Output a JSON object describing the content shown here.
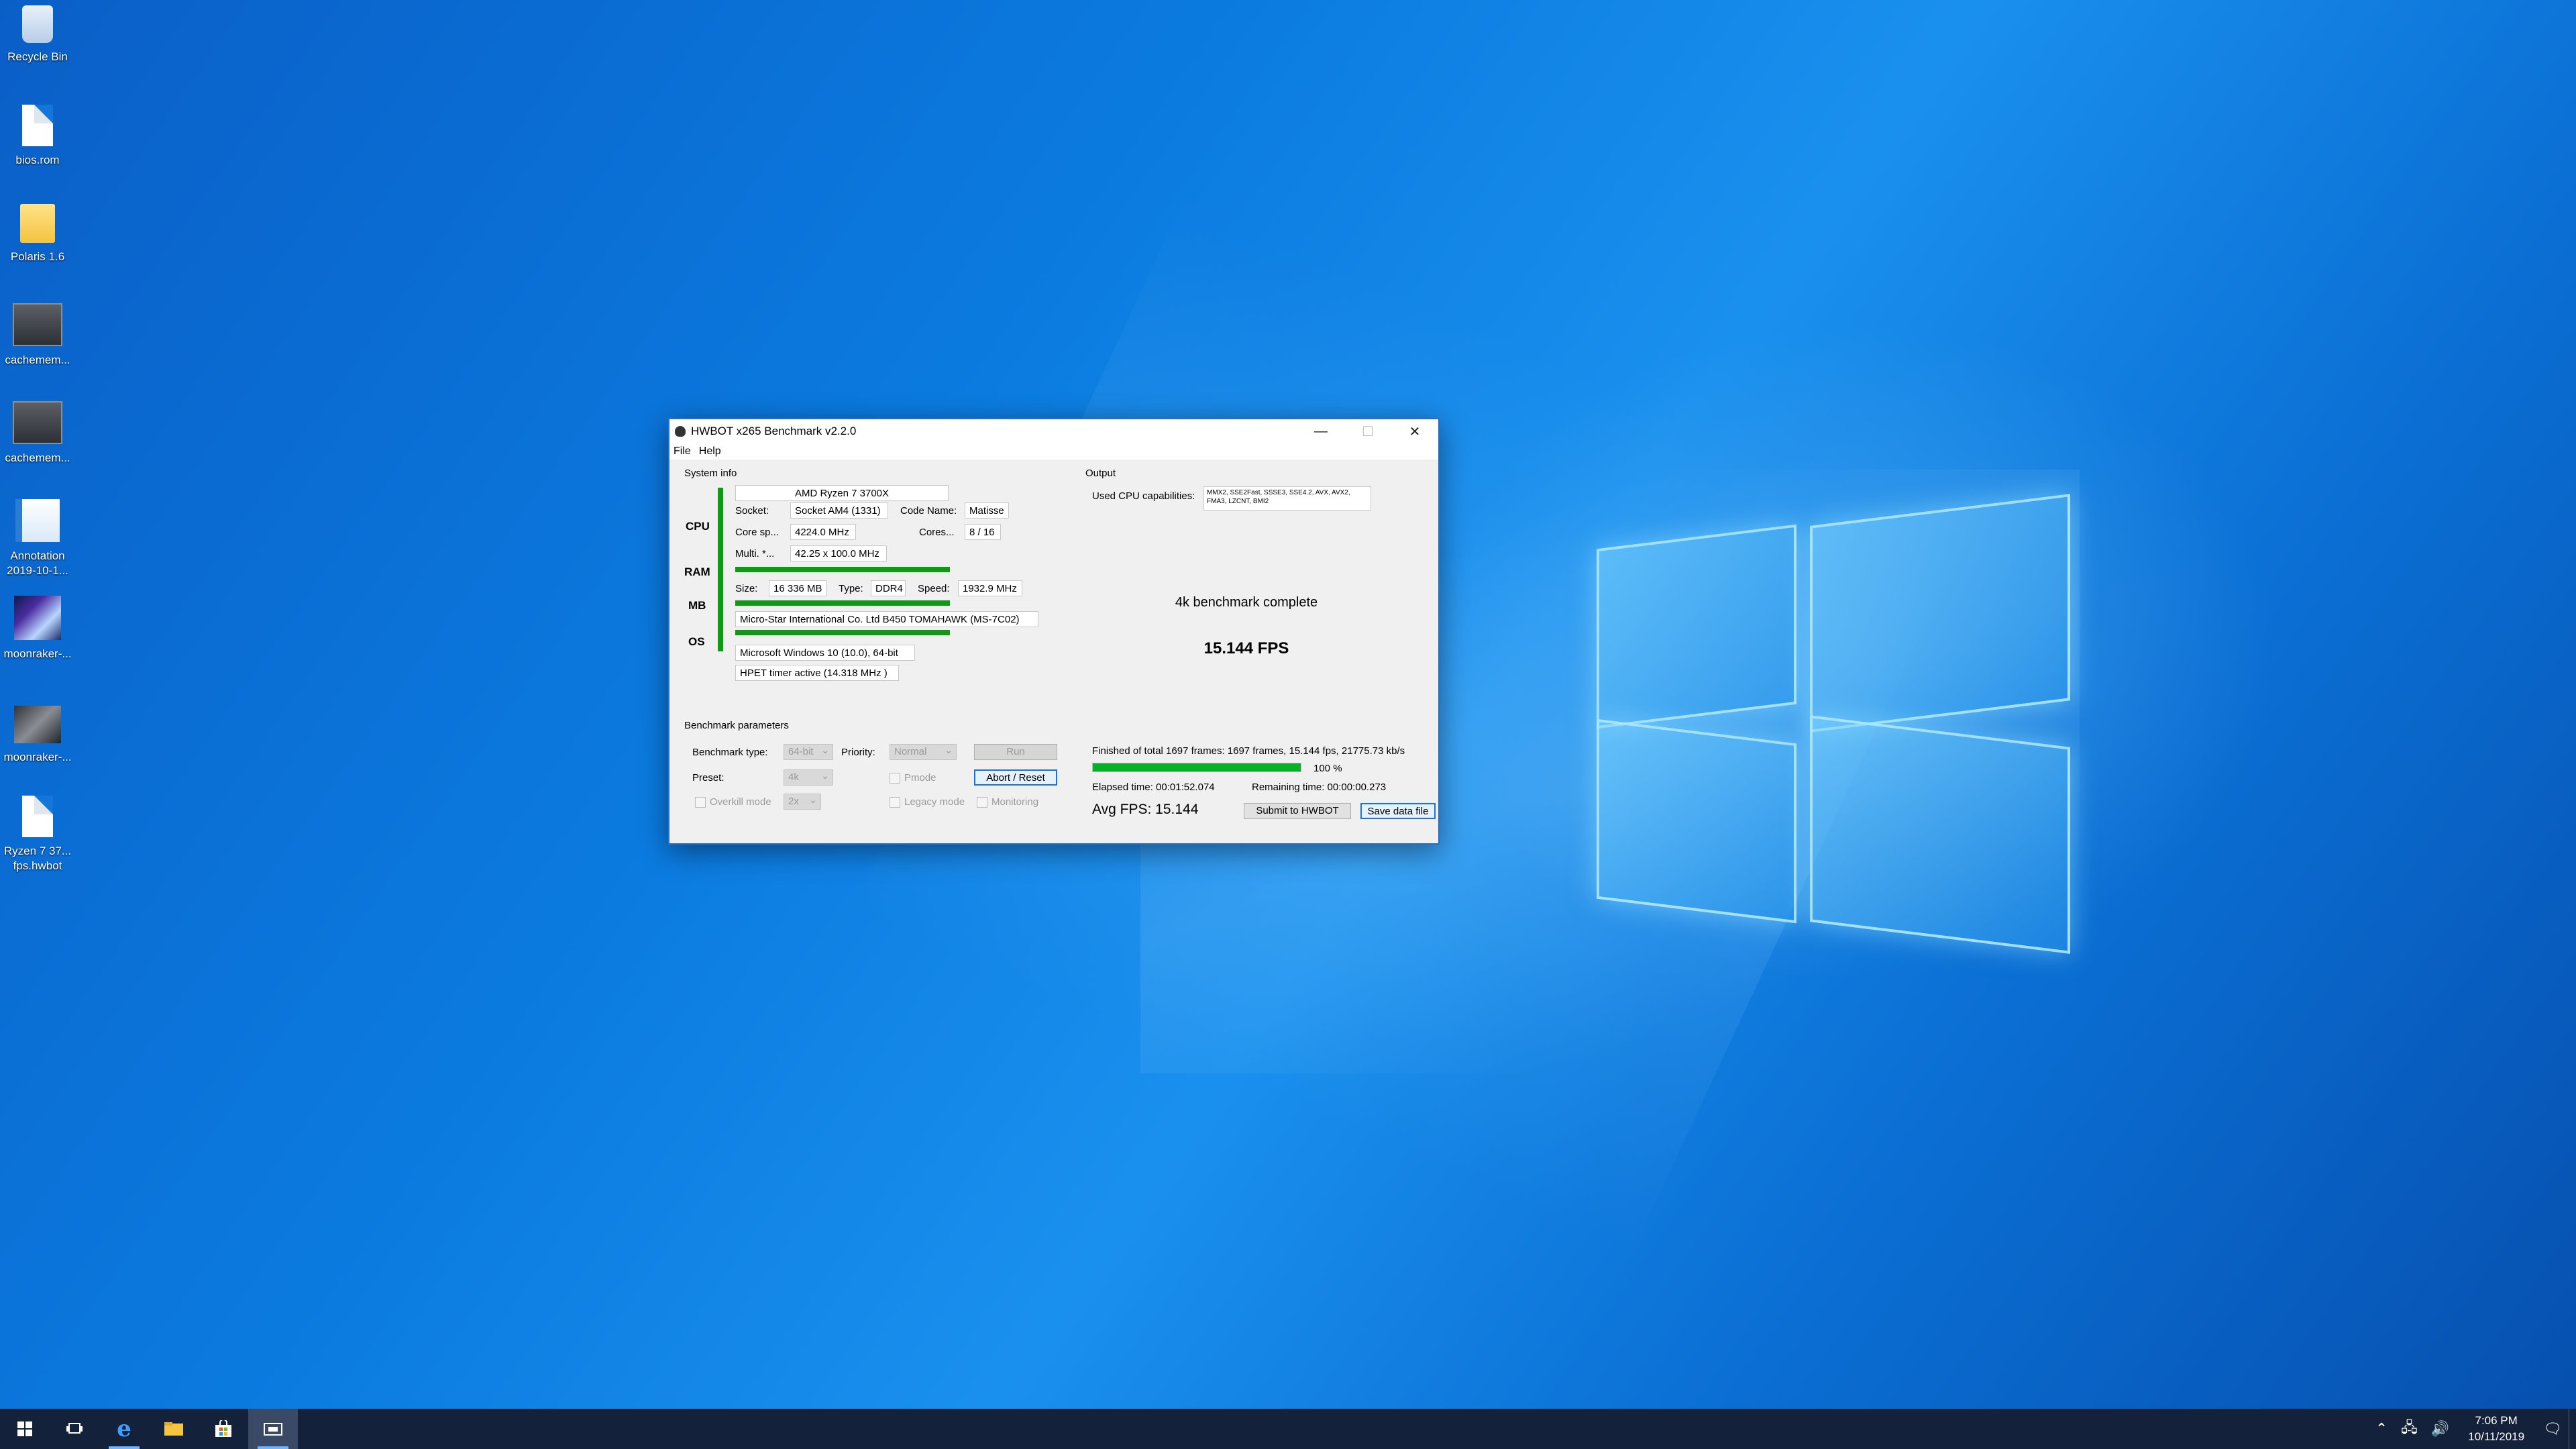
{
  "desktop": {
    "icons": [
      {
        "label": "Recycle Bin",
        "icon": "recycle-bin-icon"
      },
      {
        "label": "bios.rom",
        "icon": "file-icon"
      },
      {
        "label": "Polaris 1.6",
        "icon": "folder-icon"
      },
      {
        "label": "cachemem...",
        "icon": "image-icon"
      },
      {
        "label": "cachemem...",
        "icon": "image-icon"
      },
      {
        "label": "Annotation\n2019-10-1...",
        "icon": "image-icon"
      },
      {
        "label": "moonraker-...",
        "icon": "image-icon"
      },
      {
        "label": "moonraker-...",
        "icon": "image-icon"
      },
      {
        "label": "Ryzen 7 37...\nfps.hwbot",
        "icon": "file-icon"
      }
    ]
  },
  "window": {
    "title": "HWBOT x265 Benchmark v2.2.0",
    "menu": {
      "file": "File",
      "help": "Help"
    },
    "controls": {
      "minimize": "—",
      "maximize": "☐",
      "close": "✕"
    }
  },
  "sysinfo": {
    "heading": "System info",
    "cpu_name": "AMD Ryzen 7 3700X",
    "socket_label": "Socket:",
    "socket": "Socket AM4 (1331)",
    "codename_label": "Code Name:",
    "codename": "Matisse",
    "corespeed_label": "Core sp...",
    "corespeed": "4224.0 MHz",
    "cores_label": "Cores...",
    "cores": "8 / 16",
    "multi_label": "Multi. *...",
    "multi": "42.25 x 100.0 MHz",
    "size_label": "Size:",
    "size": "16 336 MB",
    "type_label": "Type:",
    "type": "DDR4",
    "speed_label": "Speed:",
    "speed": "1932.9 MHz",
    "mb": "Micro-Star International Co. Ltd B450 TOMAHAWK (MS-7C02)",
    "os": "Microsoft Windows 10 (10.0), 64-bit",
    "timer": "HPET timer active (14.318 MHz )",
    "side": {
      "cpu": "CPU",
      "ram": "RAM",
      "mb": "MB",
      "os": "OS"
    }
  },
  "params": {
    "heading": "Benchmark parameters",
    "type_label": "Benchmark type:",
    "type_value": "64-bit",
    "priority_label": "Priority:",
    "priority_value": "Normal",
    "run": "Run",
    "preset_label": "Preset:",
    "preset_value": "4k",
    "pmode": "Pmode",
    "abort": "Abort / Reset",
    "overkill": "Overkill mode",
    "overkill_value": "2x",
    "legacy": "Legacy mode",
    "monitoring": "Monitoring"
  },
  "output": {
    "heading": "Output",
    "caps_label": "Used CPU capabilities:",
    "caps": "MMX2, SSE2Fast, SSSE3, SSE4.2, AVX, AVX2, FMA3, LZCNT, BMI2",
    "status": "4k benchmark complete",
    "fps_big": "15.144 FPS",
    "finished": "Finished of total 1697 frames: 1697 frames, 15.144 fps,  21775.73 kb/s",
    "progress_pct": "100 %",
    "progress_value": 100,
    "elapsed": "Elapsed time: 00:01:52.074",
    "remaining": "Remaining time: 00:00:00.273",
    "avg_fps": "Avg FPS: 15.144",
    "submit": "Submit to HWBOT",
    "save": "Save data file"
  },
  "taskbar": {
    "time": "7:06 PM",
    "date": "10/11/2019"
  }
}
